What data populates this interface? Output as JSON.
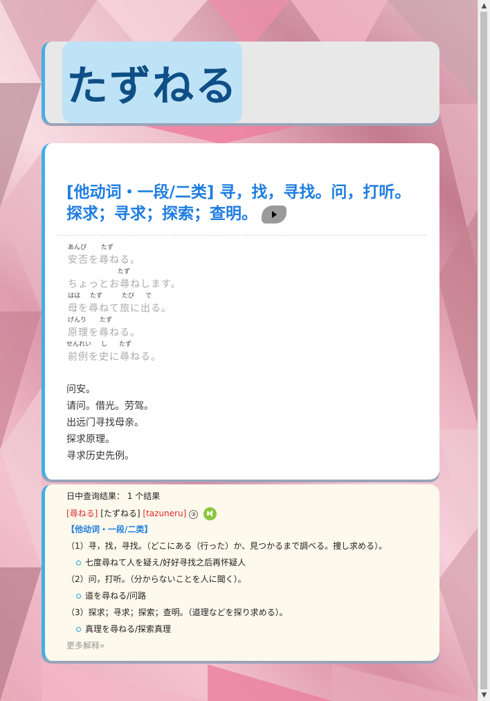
{
  "word": {
    "title": "たずねる"
  },
  "definition": {
    "heading": "[他动词・一段/二类] 寻，找，寻找。问，打听。探求；寻求；探索；查明。",
    "examples": [
      {
        "furi": [
          [
            "あんぴ",
            2
          ],
          [
            "たず",
            50
          ]
        ],
        "text": "安否を尋ねる。"
      },
      {
        "furi": [
          [
            "たず",
            74
          ]
        ],
        "text": "ちょっとお尋ねします。"
      },
      {
        "furi": [
          [
            "はは",
            2
          ],
          [
            "たず",
            34
          ],
          [
            "たび",
            80
          ],
          [
            "で",
            114
          ]
        ],
        "text": "母を尋ねて旅に出る。"
      },
      {
        "furi": [
          [
            "げんり",
            2
          ],
          [
            "たず",
            48
          ]
        ],
        "text": "原理を尋ねる。"
      },
      {
        "furi": [
          [
            "せんれい",
            0
          ],
          [
            "し",
            50
          ],
          [
            "たず",
            76
          ]
        ],
        "text": "前例を史に尋ねる。"
      }
    ],
    "translations": [
      "问安。",
      "请问。借光。劳驾。",
      "出远门寻找母亲。",
      "探求原理。",
      "寻求历史先例。"
    ]
  },
  "dict": {
    "summary": "日中查询结果：  1 个结果",
    "entry_kanji": "[尋ねる]",
    "entry_kana": "[たずねる]",
    "entry_romaji": "[tazuneru]",
    "entry_num": "③",
    "pos": "【他动词・一段/二类】",
    "senses": [
      {
        "def": "（1）寻，找，寻找。（どこにある（行った）か、見つかるまで調べる。捜し求める）。",
        "ex": "七度尋ねて人を疑え/好好寻找之后再怀疑人"
      },
      {
        "def": "（2）问，打听。（分からないことを人に聞く）。",
        "ex": "道を尋ねる/问路"
      },
      {
        "def": "（3）探求；寻求；探索；查明。（道理などを探り求める）。",
        "ex": "真理を尋ねる/探索真理"
      }
    ],
    "more": "更多解释»"
  },
  "colors": {
    "accent": "#3fb0e6",
    "heading": "#1f7de0",
    "title_bg": "#bfe3f6",
    "title_text": "#0f4f86",
    "red": "#d92b2b"
  },
  "icons": {
    "play": "play-icon",
    "speaker": "speaker-icon"
  }
}
